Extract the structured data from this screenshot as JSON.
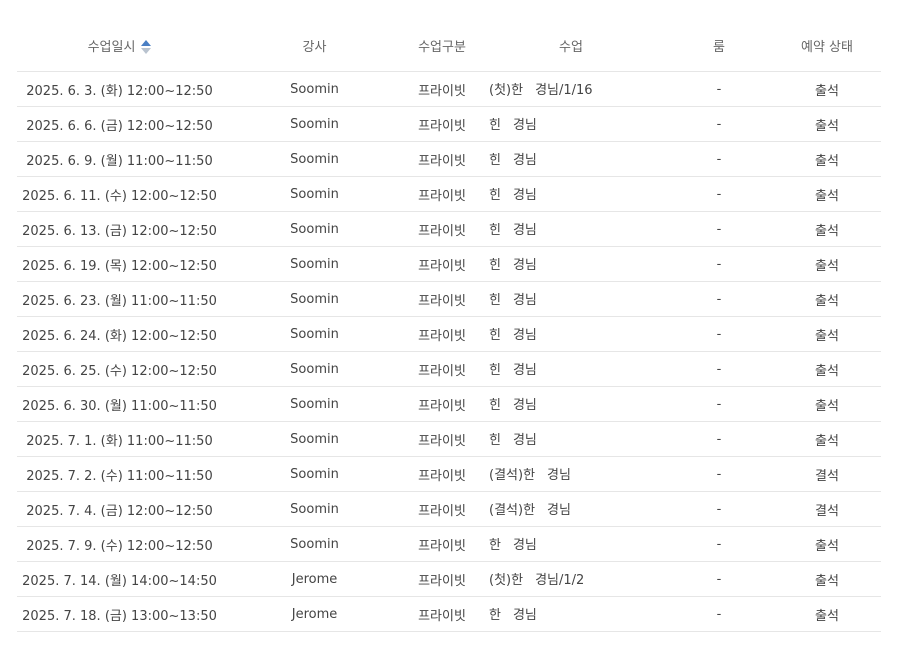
{
  "table": {
    "headers": {
      "datetime": "수업일시",
      "teacher": "강사",
      "type": "수업구분",
      "lesson": "수업",
      "room": "룸",
      "status": "예약 상태"
    },
    "sort_icon": "sort-ascending-icon",
    "rows": [
      {
        "datetime": "2025. 6. 3. (화) 12:00~12:50",
        "teacher": "Soomin",
        "type": "프라이빗",
        "lesson_prefix": "(첫)한",
        "lesson_suffix": "경님/1/16",
        "room": "-",
        "status": "출석"
      },
      {
        "datetime": "2025. 6. 6. (금) 12:00~12:50",
        "teacher": "Soomin",
        "type": "프라이빗",
        "lesson_prefix": "힌",
        "lesson_suffix": "경님",
        "room": "-",
        "status": "출석"
      },
      {
        "datetime": "2025. 6. 9. (월) 11:00~11:50",
        "teacher": "Soomin",
        "type": "프라이빗",
        "lesson_prefix": "힌",
        "lesson_suffix": "경님",
        "room": "-",
        "status": "출석"
      },
      {
        "datetime": "2025. 6. 11. (수) 12:00~12:50",
        "teacher": "Soomin",
        "type": "프라이빗",
        "lesson_prefix": "힌",
        "lesson_suffix": "경님",
        "room": "-",
        "status": "출석"
      },
      {
        "datetime": "2025. 6. 13. (금) 12:00~12:50",
        "teacher": "Soomin",
        "type": "프라이빗",
        "lesson_prefix": "힌",
        "lesson_suffix": "경님",
        "room": "-",
        "status": "출석"
      },
      {
        "datetime": "2025. 6. 19. (목) 12:00~12:50",
        "teacher": "Soomin",
        "type": "프라이빗",
        "lesson_prefix": "힌",
        "lesson_suffix": "경님",
        "room": "-",
        "status": "출석"
      },
      {
        "datetime": "2025. 6. 23. (월) 11:00~11:50",
        "teacher": "Soomin",
        "type": "프라이빗",
        "lesson_prefix": "힌",
        "lesson_suffix": "경님",
        "room": "-",
        "status": "출석"
      },
      {
        "datetime": "2025. 6. 24. (화) 12:00~12:50",
        "teacher": "Soomin",
        "type": "프라이빗",
        "lesson_prefix": "힌",
        "lesson_suffix": "경님",
        "room": "-",
        "status": "출석"
      },
      {
        "datetime": "2025. 6. 25. (수) 12:00~12:50",
        "teacher": "Soomin",
        "type": "프라이빗",
        "lesson_prefix": "힌",
        "lesson_suffix": "경님",
        "room": "-",
        "status": "출석"
      },
      {
        "datetime": "2025. 6. 30. (월) 11:00~11:50",
        "teacher": "Soomin",
        "type": "프라이빗",
        "lesson_prefix": "힌",
        "lesson_suffix": "경님",
        "room": "-",
        "status": "출석"
      },
      {
        "datetime": "2025. 7. 1. (화) 11:00~11:50",
        "teacher": "Soomin",
        "type": "프라이빗",
        "lesson_prefix": "힌",
        "lesson_suffix": "경님",
        "room": "-",
        "status": "출석"
      },
      {
        "datetime": "2025. 7. 2. (수) 11:00~11:50",
        "teacher": "Soomin",
        "type": "프라이빗",
        "lesson_prefix": "(결석)한",
        "lesson_suffix": "경님",
        "room": "-",
        "status": "결석"
      },
      {
        "datetime": "2025. 7. 4. (금) 12:00~12:50",
        "teacher": "Soomin",
        "type": "프라이빗",
        "lesson_prefix": "(결석)한",
        "lesson_suffix": "경님",
        "room": "-",
        "status": "결석"
      },
      {
        "datetime": "2025. 7. 9. (수) 12:00~12:50",
        "teacher": "Soomin",
        "type": "프라이빗",
        "lesson_prefix": "한",
        "lesson_suffix": "경님",
        "room": "-",
        "status": "출석"
      },
      {
        "datetime": "2025. 7. 14. (월) 14:00~14:50",
        "teacher": "Jerome",
        "type": "프라이빗",
        "lesson_prefix": "(첫)한",
        "lesson_suffix": "경님/1/2",
        "room": "-",
        "status": "출석"
      },
      {
        "datetime": "2025. 7. 18. (금) 13:00~13:50",
        "teacher": "Jerome",
        "type": "프라이빗",
        "lesson_prefix": "한",
        "lesson_suffix": "경님",
        "room": "-",
        "status": "출석"
      }
    ]
  }
}
